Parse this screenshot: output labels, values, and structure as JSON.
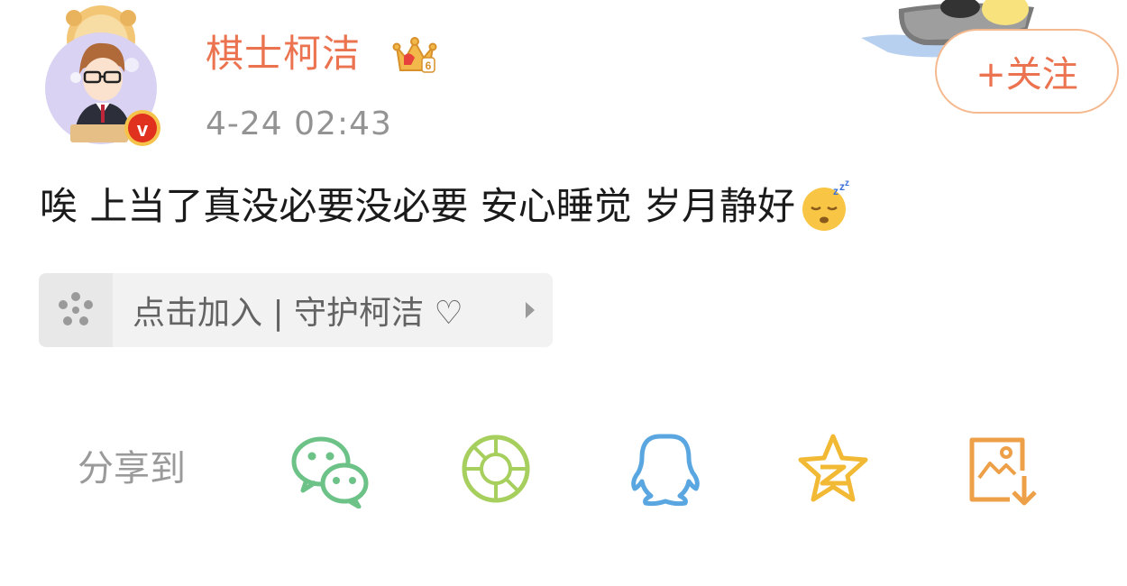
{
  "post": {
    "username": "棋士柯洁",
    "timestamp": "4-24 02:43",
    "follow_label": "+关注",
    "text": "唉 上当了真没必要没必要  安心睡觉 岁月静好",
    "emoji": "sleeping-face-icon"
  },
  "fan_group": {
    "label": "点击加入 | 守护柯洁 ♡"
  },
  "share": {
    "label": "分享到",
    "targets": [
      {
        "name": "wechat-icon",
        "color": "#6cc287"
      },
      {
        "name": "moments-icon",
        "color": "#a6cf5d"
      },
      {
        "name": "qq-icon",
        "color": "#5aa6e0"
      },
      {
        "name": "qzone-icon",
        "color": "#f2b935"
      },
      {
        "name": "save-image-icon",
        "color": "#eda048"
      }
    ]
  },
  "colors": {
    "accent": "#eb7350",
    "verified_badge": "#e0301e"
  }
}
